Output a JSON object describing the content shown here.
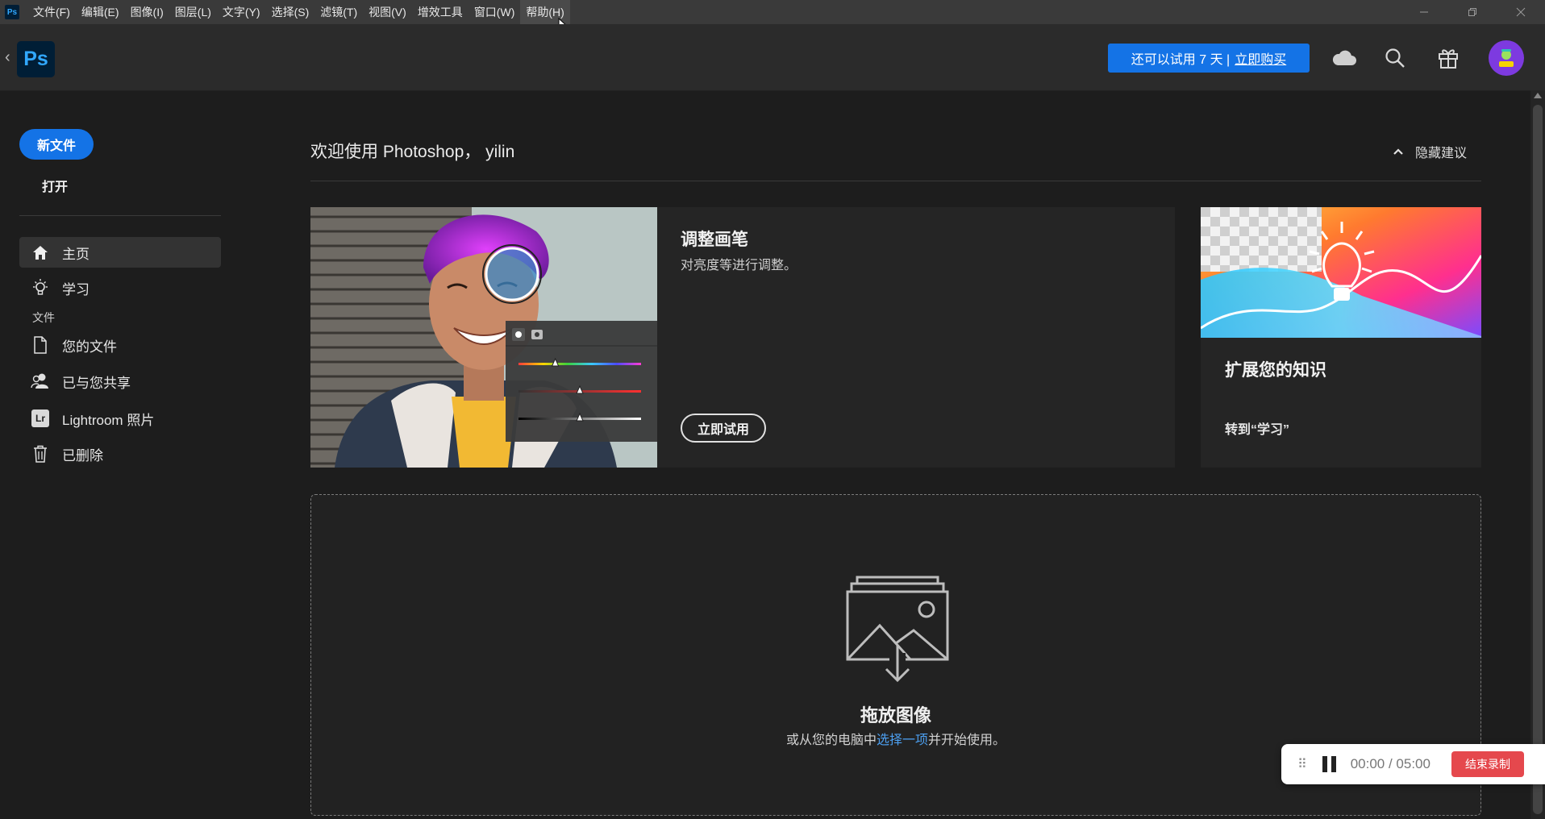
{
  "menubar": {
    "app_badge": "Ps",
    "items": [
      "文件(F)",
      "编辑(E)",
      "图像(I)",
      "图层(L)",
      "文字(Y)",
      "选择(S)",
      "滤镜(T)",
      "视图(V)",
      "增效工具",
      "窗口(W)",
      "帮助(H)"
    ]
  },
  "header": {
    "logo": "Ps",
    "trial_text": "还可以试用 7 天 |",
    "trial_link": "立即购买",
    "icons": [
      "cloud-icon",
      "search-icon",
      "gift-icon",
      "avatar"
    ]
  },
  "sidebar": {
    "new_file": "新文件",
    "open": "打开",
    "items": [
      {
        "label": "主页",
        "icon": "home-icon"
      },
      {
        "label": "学习",
        "icon": "lightbulb-icon"
      }
    ],
    "section_files": "文件",
    "file_items": [
      {
        "label": "您的文件",
        "icon": "document-icon"
      },
      {
        "label": "已与您共享",
        "icon": "shared-user-icon"
      },
      {
        "label": "Lightroom 照片",
        "icon": "lightroom-icon",
        "badge": "Lr"
      },
      {
        "label": "已删除",
        "icon": "trash-icon"
      }
    ]
  },
  "main": {
    "welcome": "欢迎使用 Photoshop， yilin",
    "hide_tips": "隐藏建议",
    "card1": {
      "title": "调整画笔",
      "desc": "对亮度等进行调整。",
      "button": "立即试用",
      "slider_values": [
        0.3,
        0.5,
        0.5
      ]
    },
    "card2": {
      "title": "扩展您的知识",
      "link": "转到“学习”"
    },
    "dropzone": {
      "title": "拖放图像",
      "sub_prefix": "或从您的电脑中",
      "sub_link": "选择一项",
      "sub_suffix": "并开始使用。"
    }
  },
  "recorder": {
    "time": "00:00 / 05:00",
    "end_button": "结束录制"
  },
  "colors": {
    "accent": "#1473e6",
    "background": "#1d1d1d",
    "card": "#252525",
    "record_red": "#e5484d"
  }
}
